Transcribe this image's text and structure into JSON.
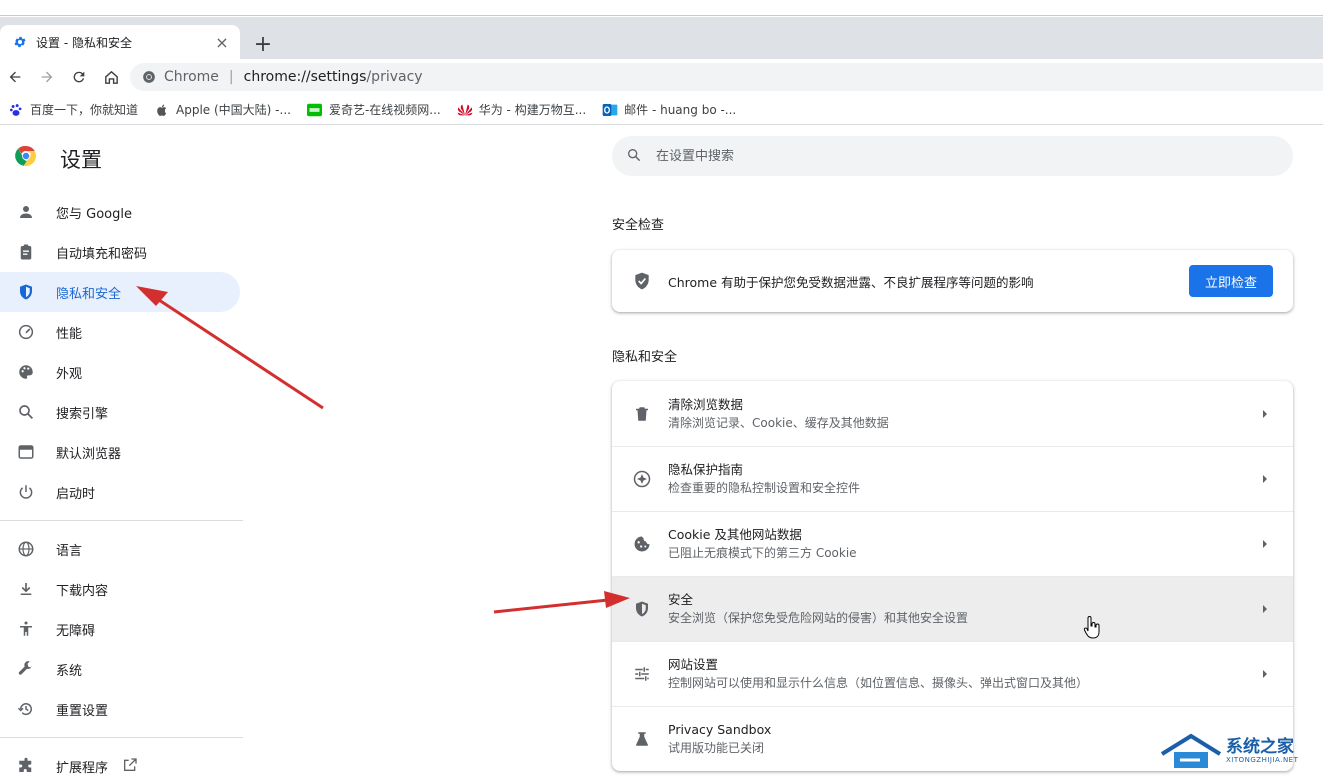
{
  "tab": {
    "title": "设置 - 隐私和安全",
    "close_glyph": "×",
    "new_tab_glyph": "+"
  },
  "omnibox": {
    "site_label": "Chrome",
    "separator": "|",
    "host": "chrome://settings",
    "path": "/privacy"
  },
  "bookmarks": [
    {
      "label": "百度一下，你就知道",
      "icon": "baidu-icon"
    },
    {
      "label": "Apple (中国大陆) -...",
      "icon": "apple-icon"
    },
    {
      "label": "爱奇艺-在线视频网...",
      "icon": "iqiyi-icon"
    },
    {
      "label": "华为 - 构建万物互...",
      "icon": "huawei-icon"
    },
    {
      "label": "邮件 - huang bo -...",
      "icon": "outlook-icon"
    }
  ],
  "settings": {
    "title": "设置",
    "search_placeholder": "在设置中搜索"
  },
  "nav": {
    "items_a": [
      {
        "label": "您与 Google",
        "icon": "person-icon"
      },
      {
        "label": "自动填充和密码",
        "icon": "clipboard-icon"
      },
      {
        "label": "隐私和安全",
        "icon": "shield-icon",
        "active": true
      },
      {
        "label": "性能",
        "icon": "speedometer-icon"
      },
      {
        "label": "外观",
        "icon": "palette-icon"
      },
      {
        "label": "搜索引擎",
        "icon": "search-icon"
      },
      {
        "label": "默认浏览器",
        "icon": "browser-icon"
      },
      {
        "label": "启动时",
        "icon": "power-icon"
      }
    ],
    "items_b": [
      {
        "label": "语言",
        "icon": "globe-icon"
      },
      {
        "label": "下载内容",
        "icon": "download-icon"
      },
      {
        "label": "无障碍",
        "icon": "accessibility-icon"
      },
      {
        "label": "系统",
        "icon": "wrench-icon"
      },
      {
        "label": "重置设置",
        "icon": "history-icon"
      }
    ],
    "extensions_label": "扩展程序"
  },
  "safety_check": {
    "heading": "安全检查",
    "description": "Chrome 有助于保护您免受数据泄露、不良扩展程序等问题的影响",
    "button_label": "立即检查"
  },
  "privacy": {
    "heading": "隐私和安全",
    "rows": [
      {
        "label": "清除浏览数据",
        "sub": "清除浏览记录、Cookie、缓存及其他数据",
        "icon": "trash-icon"
      },
      {
        "label": "隐私保护指南",
        "sub": "检查重要的隐私控制设置和安全控件",
        "icon": "compass-icon"
      },
      {
        "label": "Cookie 及其他网站数据",
        "sub": "已阻止无痕模式下的第三方 Cookie",
        "icon": "cookie-icon"
      },
      {
        "label": "安全",
        "sub": "安全浏览（保护您免受危险网站的侵害）和其他安全设置",
        "icon": "shield-icon",
        "hovered": true
      },
      {
        "label": "网站设置",
        "sub": "控制网站可以使用和显示什么信息（如位置信息、摄像头、弹出式窗口及其他）",
        "icon": "tune-icon"
      },
      {
        "label": "Privacy Sandbox",
        "sub": "试用版功能已关闭",
        "icon": "flask-icon"
      }
    ]
  },
  "watermark": {
    "title": "系统之家",
    "subtitle": "XITONGZHIJIA.NET"
  },
  "colors": {
    "accent": "#1a73e8",
    "active_nav_bg": "#e8f0fe",
    "annotation_arrow": "#d32f2f"
  }
}
